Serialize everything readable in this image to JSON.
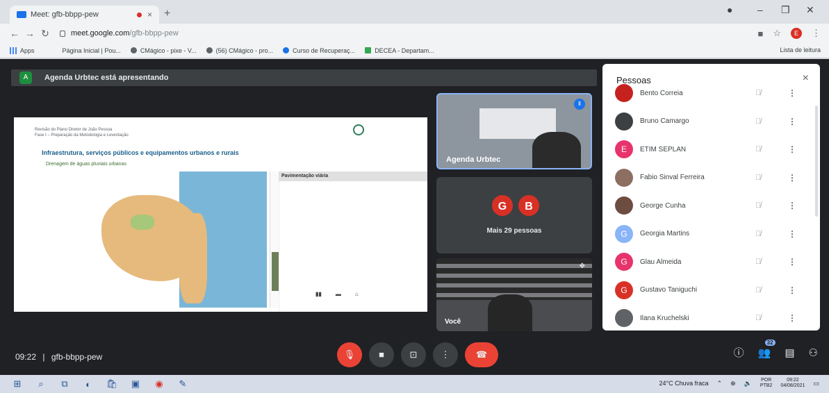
{
  "browser": {
    "tab_title": "Meet: gfb-bbpp-pew",
    "tab_close": "×",
    "new_tab": "+",
    "url_host": "meet.google.com",
    "url_path": "/gfb-bbpp-pew",
    "profile_initial": "E",
    "reading_list": "Lista de leitura",
    "bookmarks": [
      "Apps",
      "Página Inicial | Pou...",
      "CMágico - pixe - V...",
      "(56) CMágico - pro...",
      "Curso de Recuperaç...",
      "DECEA - Departam..."
    ]
  },
  "meet": {
    "presenter_initial": "A",
    "presenting_text": "Agenda Urbtec está apresentando",
    "slide": {
      "header_line1": "Revisão do Plano Diretor de João Pessoa",
      "header_line2": "Fase I – Preparação da Metodologia e Leventação",
      "title": "Infraestrutura, serviços públicos e equipamentos urbanos e rurais",
      "subtitle": "Drenagem de águas pluviais urbanas",
      "panel_label": "Pavimentação viária"
    },
    "tiles": {
      "presenter_name": "Agenda Urbtec",
      "circle_a": "G",
      "circle_b": "B",
      "more_people": "Mais 29 pessoas",
      "self_name": "Você"
    },
    "clock": "09:22",
    "separator": "|",
    "meeting_code": "gfb-bbpp-pew",
    "people_count": "32"
  },
  "people_panel": {
    "title": "Pessoas",
    "close": "×",
    "people": [
      {
        "name": "Bento Correia",
        "initial": "",
        "color": "#c5221f"
      },
      {
        "name": "Bruno Camargo",
        "initial": "",
        "color": "#3c4043"
      },
      {
        "name": "ETIM SEPLAN",
        "initial": "E",
        "color": "#e8336d"
      },
      {
        "name": "Fabio Sinval Ferreira",
        "initial": "",
        "color": "#8d6e63"
      },
      {
        "name": "George Cunha",
        "initial": "",
        "color": "#6d4c41"
      },
      {
        "name": "Georgia Martins",
        "initial": "G",
        "color": "#8ab4f8"
      },
      {
        "name": "Glau Almeida",
        "initial": "G",
        "color": "#e8336d"
      },
      {
        "name": "Gustavo Taniguchi",
        "initial": "G",
        "color": "#d93025"
      },
      {
        "name": "Ilana Kruchelski",
        "initial": "",
        "color": "#5f6368"
      }
    ]
  },
  "taskbar": {
    "weather": "24°C Chuva fraca",
    "lang1": "POR",
    "lang2": "PTB2",
    "time": "09:22",
    "date": "04/08/2021"
  },
  "icons": [
    "windows-icon",
    "search-icon",
    "task-view-icon",
    "edge-icon",
    "store-icon",
    "chrome-icon",
    "mic-off-icon",
    "camera-icon",
    "present-icon",
    "more-icon",
    "hangup-icon",
    "info-icon",
    "people-icon",
    "chat-icon",
    "activities-icon"
  ]
}
